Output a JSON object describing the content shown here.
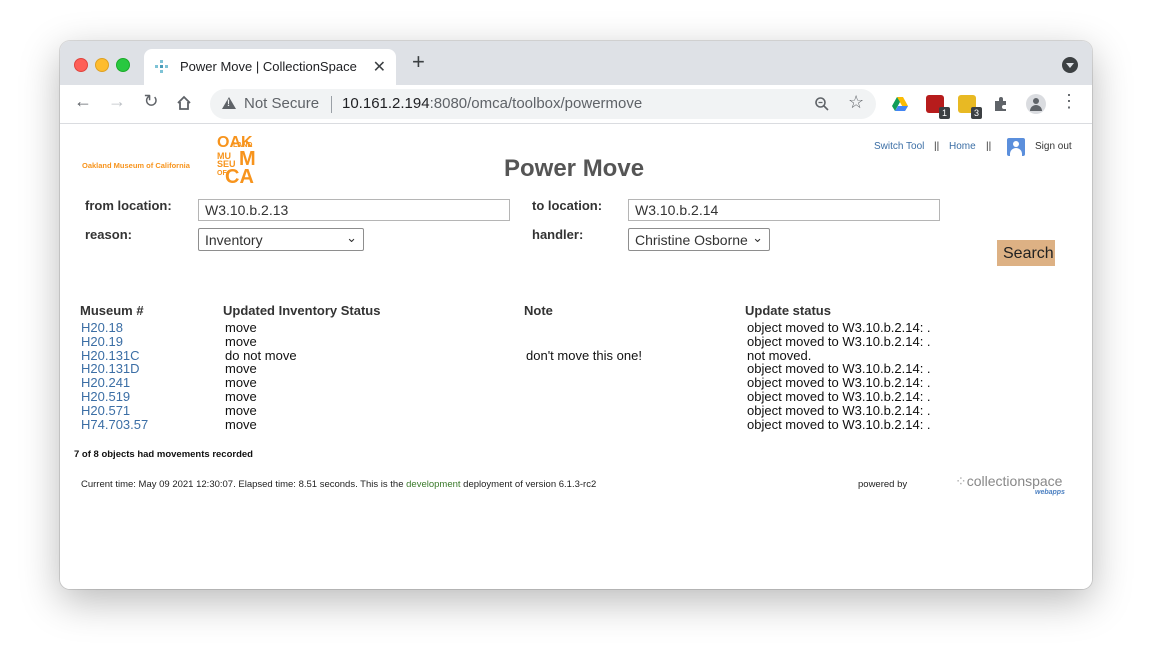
{
  "browser": {
    "tab_title": "Power Move | CollectionSpace",
    "security_label": "Not Secure",
    "url_host": "10.161.2.194",
    "url_path": ":8080/omca/toolbox/powermove",
    "extension_badges": [
      "1",
      "3"
    ]
  },
  "header": {
    "museum_name": "Oakland Museum of California",
    "logo_lines": [
      "OAK",
      "LAND",
      "MU",
      "SEU",
      "M",
      "OF",
      "CA"
    ],
    "title": "Power Move",
    "nav": {
      "switch_tool": "Switch Tool",
      "separator": "||",
      "home": "Home",
      "sign_out": "Sign out"
    }
  },
  "form": {
    "from_label": "from location:",
    "from_value": "W3.10.b.2.13",
    "to_label": "to location:",
    "to_value": "W3.10.b.2.14",
    "reason_label": "reason:",
    "reason_value": "Inventory",
    "handler_label": "handler:",
    "handler_value": "Christine Osborne",
    "search_label": "Search"
  },
  "table": {
    "headers": [
      "Museum #",
      "Updated Inventory Status",
      "Note",
      "Update status"
    ],
    "rows": [
      {
        "museum_number": "H20.18",
        "status": "move",
        "note": "",
        "update": "object moved to W3.10.b.2.14: ."
      },
      {
        "museum_number": "H20.19",
        "status": "move",
        "note": "",
        "update": "object moved to W3.10.b.2.14: ."
      },
      {
        "museum_number": "H20.131C",
        "status": "do not move",
        "note": "don't move this one!",
        "update": "not moved."
      },
      {
        "museum_number": "H20.131D",
        "status": "move",
        "note": "",
        "update": "object moved to W3.10.b.2.14: ."
      },
      {
        "museum_number": "H20.241",
        "status": "move",
        "note": "",
        "update": "object moved to W3.10.b.2.14: ."
      },
      {
        "museum_number": "H20.519",
        "status": "move",
        "note": "",
        "update": "object moved to W3.10.b.2.14: ."
      },
      {
        "museum_number": "H20.571",
        "status": "move",
        "note": "",
        "update": "object moved to W3.10.b.2.14: ."
      },
      {
        "museum_number": "H74.703.57",
        "status": "move",
        "note": "",
        "update": "object moved to W3.10.b.2.14: ."
      }
    ]
  },
  "summary": "7 of 8 objects had movements recorded",
  "footer": {
    "prefix": "Current time: May 09 2021 12:30:07. Elapsed time: 8.51 seconds. This is the ",
    "environment": "development",
    "suffix": " deployment of version 6.1.3-rc2",
    "powered_by": "powered by",
    "cs_name": "collectionspace",
    "cs_sub": "webapps"
  },
  "colors": {
    "accent_orange": "#f7941d",
    "link_blue": "#3b6ea5",
    "search_button": "#ddb184"
  }
}
